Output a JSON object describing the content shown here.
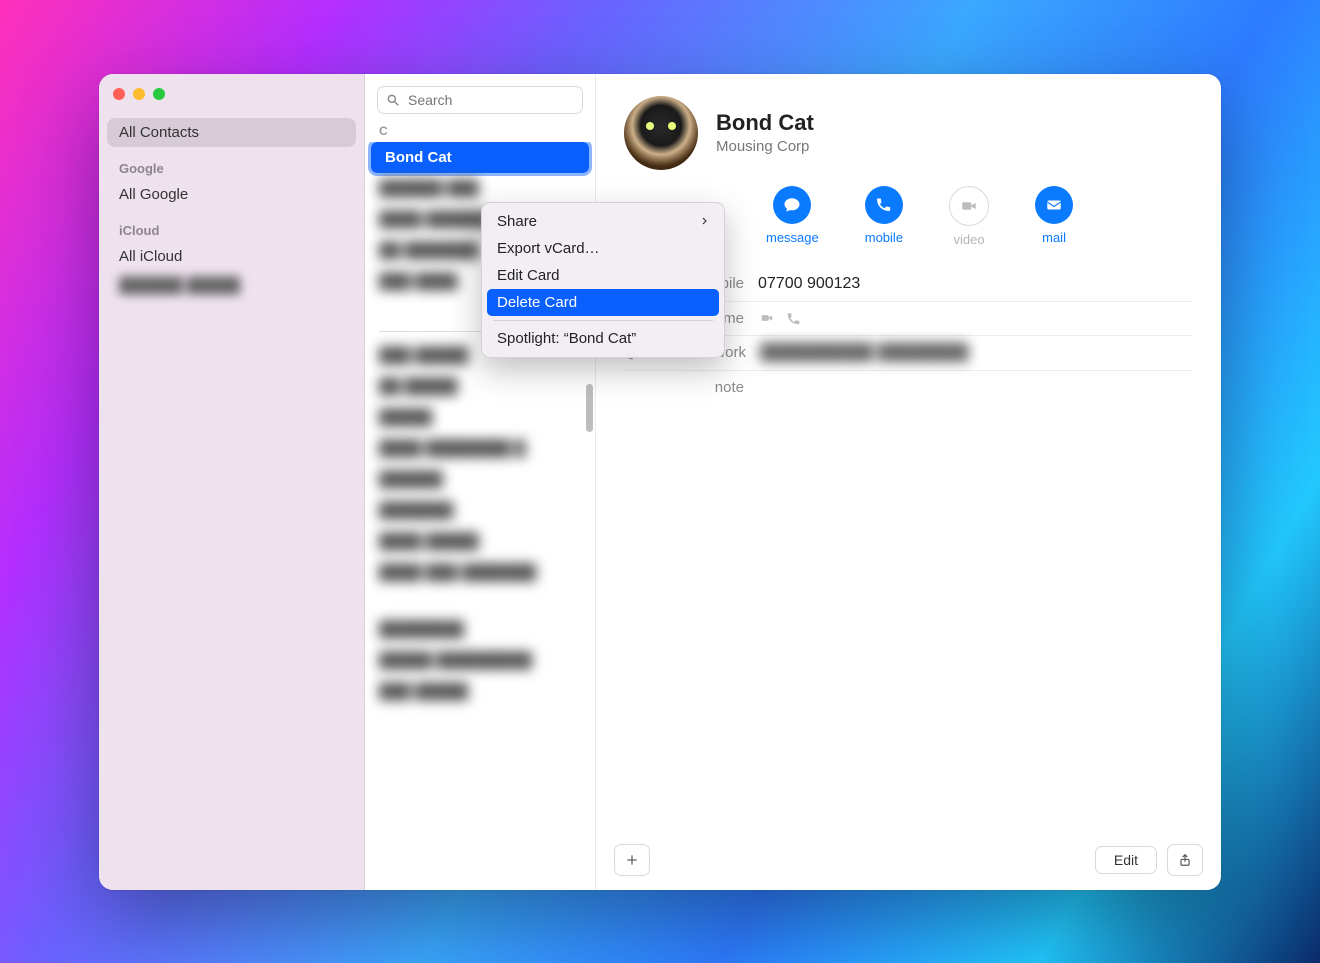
{
  "sidebar": {
    "all_contacts": "All Contacts",
    "sections": [
      {
        "title": "Google",
        "items": [
          "All Google"
        ]
      },
      {
        "title": "iCloud",
        "items": [
          "All iCloud",
          "██████ █████"
        ]
      }
    ]
  },
  "search": {
    "placeholder": "Search"
  },
  "list": {
    "letter": "C",
    "selected": "Bond Cat",
    "items_redacted_count": 5,
    "divider_after": true,
    "sep_letter": "",
    "items_redacted_below": [
      "███ █████",
      "██ █████",
      "█████",
      "████ ████████ █",
      "██████",
      "███████",
      "████ █████",
      "████ ███ ███████",
      "",
      "████████",
      "█████ █████████",
      "███ █████"
    ]
  },
  "context_menu": {
    "items": [
      {
        "label": "Share",
        "submenu": true
      },
      {
        "label": "Export vCard…"
      },
      {
        "label": "Edit Card"
      },
      {
        "label": "Delete Card",
        "highlight": true
      },
      {
        "label": "Spotlight: “Bond Cat”"
      }
    ]
  },
  "detail": {
    "name": "Bond Cat",
    "company": "Mousing Corp",
    "actions": [
      {
        "key": "message",
        "label": "message",
        "enabled": true,
        "icon": "message"
      },
      {
        "key": "mobile",
        "label": "mobile",
        "enabled": true,
        "icon": "phone"
      },
      {
        "key": "video",
        "label": "video",
        "enabled": false,
        "icon": "video"
      },
      {
        "key": "mail",
        "label": "mail",
        "enabled": true,
        "icon": "mail"
      }
    ],
    "fields": [
      {
        "label": "mobile",
        "value": "07700 900123"
      },
      {
        "label": "FaceTime",
        "value": "",
        "icons": [
          "video",
          "phone"
        ]
      },
      {
        "label": "work",
        "value": "██████████ ████████",
        "verified": true
      },
      {
        "label": "note",
        "value": ""
      }
    ]
  },
  "footer": {
    "edit": "Edit"
  }
}
